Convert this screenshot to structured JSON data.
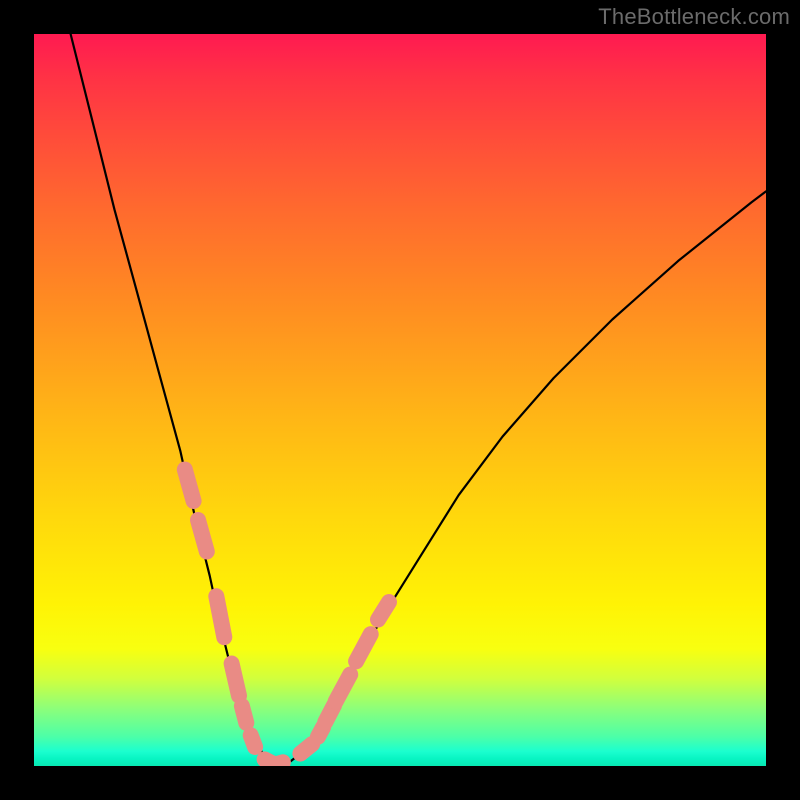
{
  "watermark": "TheBottleneck.com",
  "colors": {
    "frame": "#000000",
    "curve": "#000000",
    "marker": "#e98b85",
    "gradient_stops": [
      "#ff1a51",
      "#ff3245",
      "#ff4c3a",
      "#ff6a2e",
      "#ff8a22",
      "#ffb516",
      "#ffd80c",
      "#fff305",
      "#f8ff10",
      "#d2ff3c",
      "#8fff78",
      "#4cffa8",
      "#1bffcf",
      "#08f5c3",
      "#08e8b3"
    ]
  },
  "chart_data": {
    "type": "line",
    "title": "",
    "xlabel": "",
    "ylabel": "",
    "xlim": [
      0,
      100
    ],
    "ylim": [
      0,
      100
    ],
    "series": [
      {
        "name": "bottleneck-curve",
        "x": [
          5,
          8,
          11,
          14,
          17,
          20,
          22,
          24,
          25.5,
          27,
          28.5,
          30,
          31.5,
          33,
          35,
          38,
          41,
          44,
          48,
          53,
          58,
          64,
          71,
          79,
          88,
          98,
          100
        ],
        "y": [
          100,
          88,
          76,
          65,
          54,
          43,
          34,
          26,
          19,
          13,
          8,
          4,
          1.2,
          0.3,
          0.6,
          3,
          8,
          14,
          21,
          29,
          37,
          45,
          53,
          61,
          69,
          77,
          78.5
        ]
      }
    ],
    "markers": {
      "name": "highlighted-points",
      "note": "Approximate segment endpoints of the salmon dash clusters along the curve, in (x,y) chart-space units.",
      "points": [
        [
          20.6,
          40.5
        ],
        [
          21.8,
          36.2
        ],
        [
          22.4,
          33.6
        ],
        [
          23.6,
          29.3
        ],
        [
          24.9,
          23.2
        ],
        [
          26.0,
          17.6
        ],
        [
          27.0,
          14.0
        ],
        [
          28.0,
          9.6
        ],
        [
          28.4,
          8.2
        ],
        [
          29.0,
          5.9
        ],
        [
          29.6,
          4.2
        ],
        [
          30.2,
          2.6
        ],
        [
          31.5,
          0.9
        ],
        [
          32.5,
          0.4
        ],
        [
          33.3,
          0.3
        ],
        [
          34.0,
          0.5
        ],
        [
          36.4,
          1.7
        ],
        [
          38.0,
          3.0
        ],
        [
          38.8,
          4.0
        ],
        [
          39.5,
          5.3
        ],
        [
          39.8,
          6.0
        ],
        [
          41.0,
          8.3
        ],
        [
          41.2,
          8.8
        ],
        [
          43.2,
          12.5
        ],
        [
          44.0,
          14.3
        ],
        [
          46.0,
          18.0
        ],
        [
          47.0,
          20.0
        ],
        [
          48.5,
          22.4
        ]
      ]
    }
  }
}
